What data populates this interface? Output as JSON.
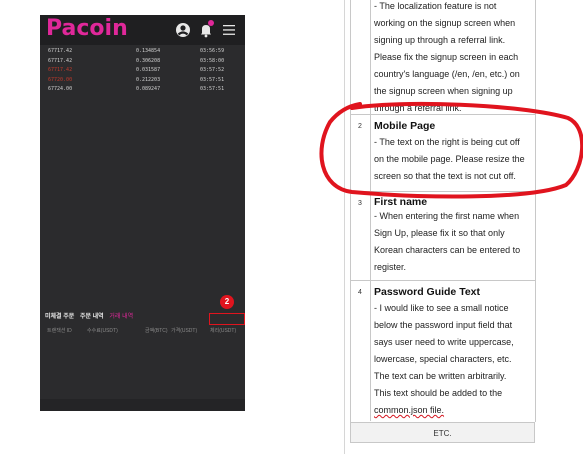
{
  "phone": {
    "logo": "Pacoin",
    "trades": [
      {
        "price": "67717.42",
        "amount": "0.134854",
        "time": "03:56:59",
        "red": false
      },
      {
        "price": "67717.42",
        "amount": "0.306208",
        "time": "03:58:00",
        "red": false
      },
      {
        "price": "67717.42",
        "amount": "0.031587",
        "time": "03:57:52",
        "red": true
      },
      {
        "price": "67720.00",
        "amount": "0.212203",
        "time": "03:57:51",
        "red": true
      },
      {
        "price": "67724.00",
        "amount": "0.089247",
        "time": "03:57:51",
        "red": false
      }
    ],
    "tabs": [
      "미체결 주문",
      "주문 내역",
      "거래 내역"
    ],
    "columns": [
      "트랜잭션 ID",
      "수수료(USDT)",
      "금액(BTC)",
      "가격(USDT)",
      "체리(USDT)"
    ],
    "badge_number": "2"
  },
  "doc": {
    "row1_text": [
      "- The localization feature is not",
      "working on the signup screen when",
      "signing up through a referral link.",
      "Please fix the signup screen in each",
      "country's language (/en, /en, etc.) on",
      "the signup screen when signing up",
      "through a referral link."
    ],
    "rows": [
      {
        "num": "2",
        "title": "Mobile Page",
        "body": [
          "- The text on the right is being cut off",
          "on the mobile page. Please resize the",
          "screen so that the text is not cut off."
        ]
      },
      {
        "num": "3",
        "title": "First name",
        "body": [
          "- When entering the first name when",
          "Sign Up, please fix it so that only",
          "Korean characters can be entered to",
          "register."
        ]
      },
      {
        "num": "4",
        "title": "Password Guide Text",
        "body": [
          "- I would like to see a small notice",
          "below the password input field that",
          "says user need to write uppercase,",
          "lowercase, special characters, etc.",
          "The text can be written arbitrarily.",
          "This text should be added to the",
          "common.json file."
        ]
      }
    ],
    "etc_label": "ETC."
  }
}
